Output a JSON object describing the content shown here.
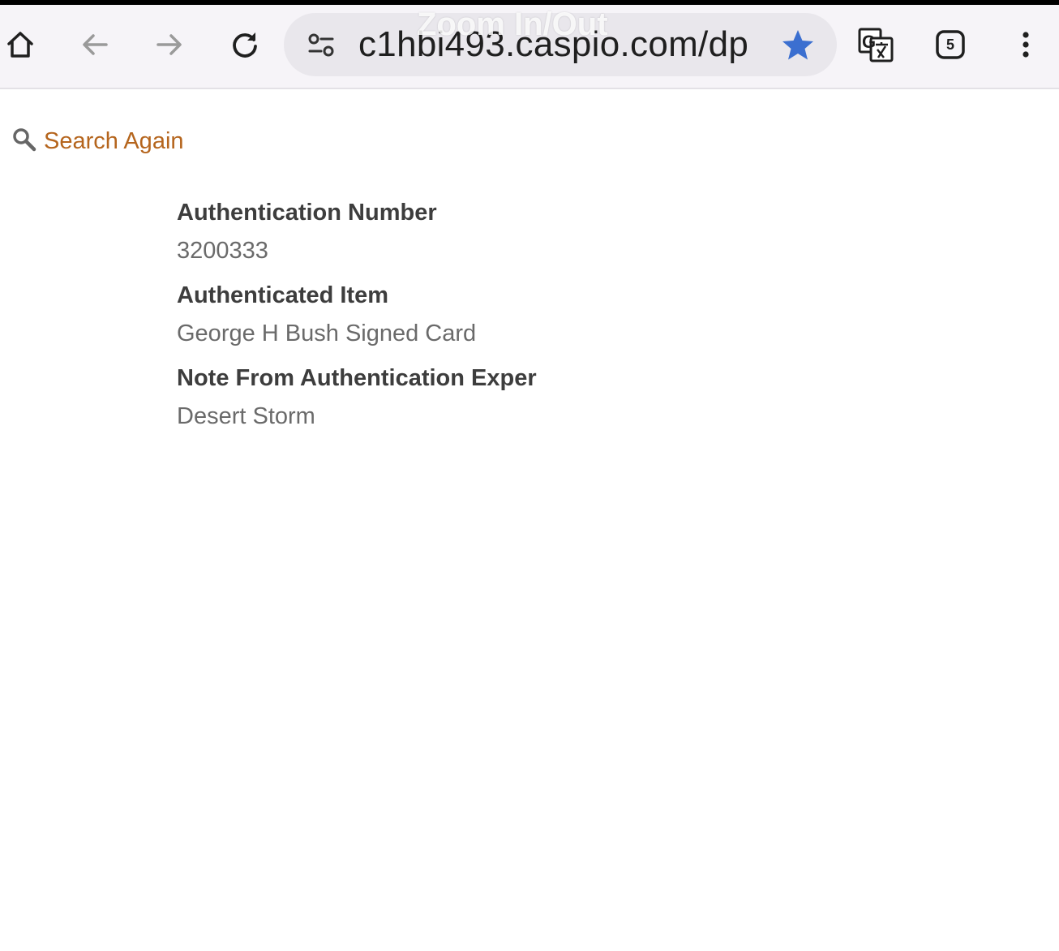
{
  "browser": {
    "url": "c1hbi493.caspio.com/dp",
    "overlay_text": "Zoom In/Out",
    "tab_count": "5",
    "icons": [
      "home-icon",
      "back-icon",
      "forward-icon",
      "reload-icon",
      "site-settings-icon",
      "bookmark-star-icon",
      "translate-icon",
      "tabs-icon",
      "more-menu-icon"
    ],
    "colors": {
      "star": "#3b6fd0",
      "toolbar": "#f6f4f8",
      "omnibox": "#e9e7ec"
    }
  },
  "page": {
    "search_again_label": "Search Again",
    "link_color": "#b5651d",
    "fields": [
      {
        "label": "Authentication Number",
        "value": "3200333"
      },
      {
        "label": "Authenticated Item",
        "value": "George H Bush Signed Card"
      },
      {
        "label": "Note From Authentication Exper",
        "value": "Desert Storm"
      }
    ]
  }
}
